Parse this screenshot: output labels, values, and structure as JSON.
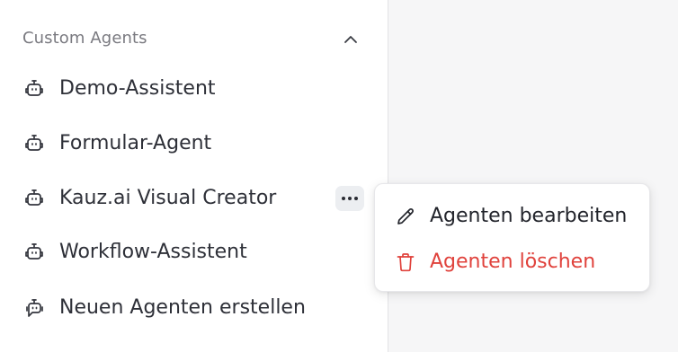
{
  "sidebar": {
    "section": {
      "title": "Custom Agents",
      "collapse_icon": "chevron-up-icon"
    },
    "items": [
      {
        "label": "Demo-Assistent",
        "icon": "robot-icon"
      },
      {
        "label": "Formular-Agent",
        "icon": "robot-icon"
      },
      {
        "label": "Kauz.ai Visual Creator",
        "icon": "robot-icon",
        "more_icon": "more-horizontal-icon"
      },
      {
        "label": "Workflow-Assistent",
        "icon": "robot-icon"
      },
      {
        "label": "Neuen Agenten erstellen",
        "icon": "robot-chat-icon"
      }
    ]
  },
  "context_menu": {
    "items": [
      {
        "label": "Agenten bearbeiten",
        "icon": "pencil-icon"
      },
      {
        "label": "Agenten löschen",
        "icon": "trash-icon"
      }
    ]
  },
  "colors": {
    "text_primary": "#2e3038",
    "text_muted": "#7a7a80",
    "danger": "#e0423c",
    "main_background": "#f6f6f7"
  }
}
